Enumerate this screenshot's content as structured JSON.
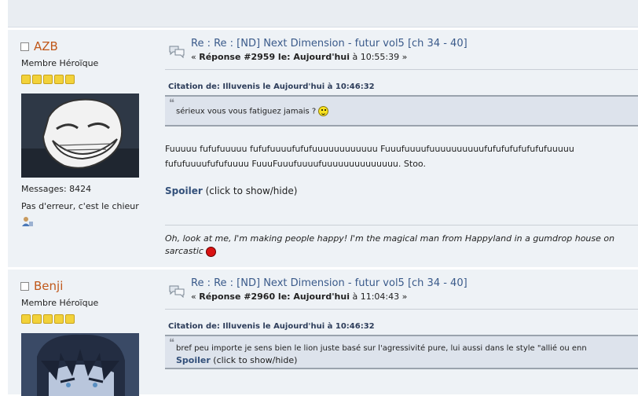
{
  "posts": [
    {
      "username": "AZB",
      "rank": "Membre Héroïque",
      "messages_label": "Messages: 8424",
      "personal_text": "Pas d'erreur, c'est le chieur",
      "title": "Re : Re : [ND] Next Dimension - futur vol5 [ch 34 - 40]",
      "reply_prefix": "« ",
      "reply_bold": "Réponse #2959 le: Aujourd'hui",
      "reply_suffix": " à 10:55:39 »",
      "citation": "Citation de: Illuvenis le Aujourd'hui à 10:46:32",
      "quote_text": "sérieux vous vous fatiguez jamais ?",
      "body_line1": "Fuuuuu fufufuuuuu fufufuuuufufufuuuuuuuuuuuu Fuuufuuuufuuuuuuuuuufufufufufufufufuuuuu",
      "body_line2": "fufufuuuufufufuuuu  FuuuFuuufuuuufuuuuuuuuuuuuuu. Stoo.",
      "spoiler_label": "Spoiler",
      "spoiler_hint": " (click to show/hide)",
      "signature_line1": "Oh, look at me, I'm making people happy! I'm the magical man from Happyland in a gumdrop house on",
      "signature_line2": "sarcastic"
    },
    {
      "username": "Benji",
      "rank": "Membre Héroïque",
      "title": "Re : Re : [ND] Next Dimension - futur vol5 [ch 34 - 40]",
      "reply_prefix": "« ",
      "reply_bold": "Réponse #2960 le: Aujourd'hui",
      "reply_suffix": " à 11:04:43 »",
      "citation": "Citation de: Illuvenis le Aujourd'hui à 10:46:32",
      "quote_text": "bref peu importe je sens bien le lion juste basé sur l'agressivité pure, lui aussi dans le style \"allié ou enn",
      "spoiler_label": "Spoiler",
      "spoiler_hint": " (click to show/hide)"
    }
  ],
  "colors": {
    "username": "#c0581a",
    "title": "#3a5a8a",
    "post_bg": "#eef2f6",
    "quote_bg": "#dde3ec"
  }
}
